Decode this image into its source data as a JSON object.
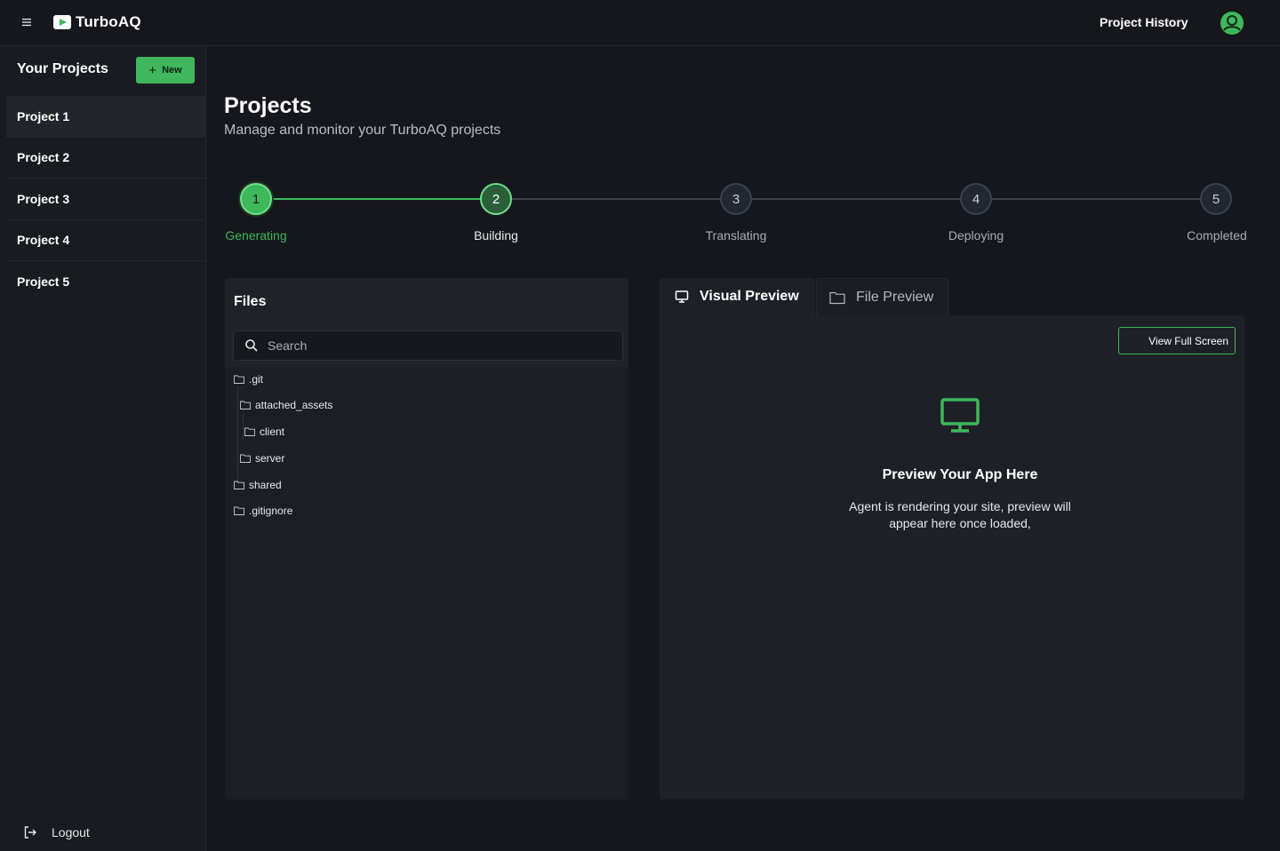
{
  "app": {
    "name": "TurboAQ",
    "nav_link": "Project History",
    "accent_color": "#3fb75c"
  },
  "sidebar": {
    "heading": "Your Projects",
    "new_button": "New",
    "projects": [
      {
        "label": "Project 1",
        "active": true
      },
      {
        "label": "Project 2",
        "active": false
      },
      {
        "label": "Project 3",
        "active": false
      },
      {
        "label": "Project 4",
        "active": false
      },
      {
        "label": "Project 5",
        "active": false
      }
    ],
    "logout": "Logout"
  },
  "main": {
    "title": "Projects",
    "subtitle": "Manage and monitor your TurboAQ projects"
  },
  "stepper": {
    "steps": [
      {
        "number": "1",
        "label": "Generating",
        "state": "done"
      },
      {
        "number": "2",
        "label": "Building",
        "state": "current"
      },
      {
        "number": "3",
        "label": "Translating",
        "state": "todo"
      },
      {
        "number": "4",
        "label": "Deploying",
        "state": "todo"
      },
      {
        "number": "5",
        "label": "Completed",
        "state": "todo"
      }
    ]
  },
  "files": {
    "title": "Files",
    "search_placeholder": "Search",
    "tree": [
      {
        "name": ".git"
      },
      {
        "name": "attached_assets"
      },
      {
        "name": "client"
      },
      {
        "name": "server"
      },
      {
        "name": "shared"
      },
      {
        "name": ".gitignore"
      }
    ]
  },
  "preview": {
    "tabs": [
      {
        "label": "Visual Preview",
        "icon": "monitor-icon",
        "active": true
      },
      {
        "label": "File Preview",
        "icon": "folder-icon",
        "active": false
      }
    ],
    "fullscreen_button": "View Full Screen",
    "empty_title": "Preview Your App Here",
    "empty_desc": "Agent is rendering your site, preview will\nappear here  once loaded,"
  }
}
